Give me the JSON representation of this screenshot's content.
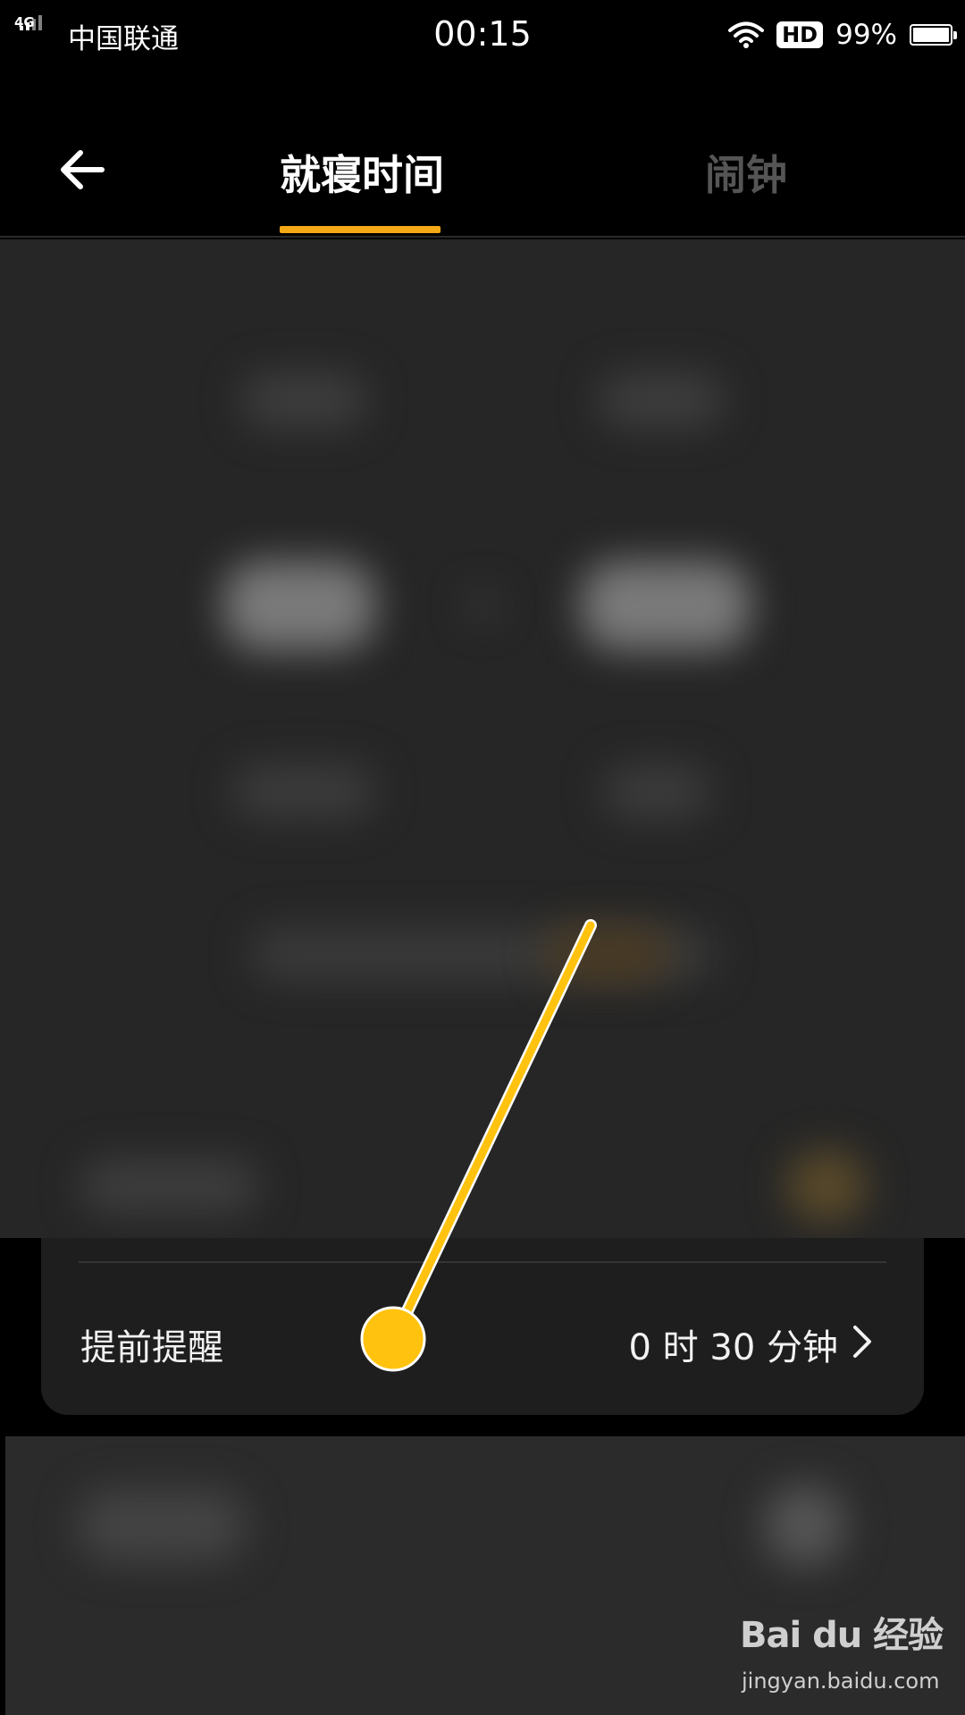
{
  "status_bar": {
    "network": "4G",
    "carrier": "中国联通",
    "time": "00:15",
    "hd": "HD",
    "battery": "99%",
    "battery_level": 0.99,
    "signal_icon": "cellular-signal-icon",
    "wifi_icon": "wifi-icon"
  },
  "header": {
    "back_icon": "arrow-left-icon",
    "tabs": [
      {
        "label": "就寝时间",
        "active": true
      },
      {
        "label": "闹钟",
        "active": false
      }
    ],
    "accent_color": "#f5a914"
  },
  "card": {
    "label": "提前提醒",
    "value": "0 时 30 分钟",
    "chevron_icon": "chevron-right-icon"
  },
  "annotation": {
    "color": "#ffc20e"
  },
  "watermark": {
    "logo": "Bai du 经验",
    "url": "jingyan.baidu.com"
  }
}
